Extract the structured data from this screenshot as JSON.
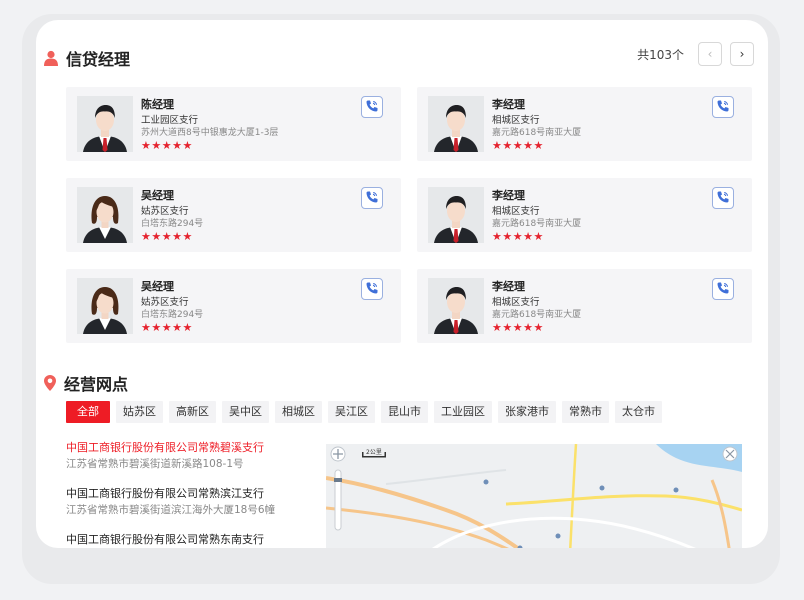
{
  "managers": {
    "title": "信贷经理",
    "total": "共103个",
    "items": [
      {
        "name": "陈经理",
        "branch": "工业园区支行",
        "address": "苏州大道西8号中银惠龙大厦1-3层",
        "stars": "★★★★★",
        "gender": "male"
      },
      {
        "name": "李经理",
        "branch": "相城区支行",
        "address": "嘉元路618号南亚大厦",
        "stars": "★★★★★",
        "gender": "male"
      },
      {
        "name": "吴经理",
        "branch": "姑苏区支行",
        "address": "白塔东路294号",
        "stars": "★★★★★",
        "gender": "female"
      },
      {
        "name": "李经理",
        "branch": "相城区支行",
        "address": "嘉元路618号南亚大厦",
        "stars": "★★★★★",
        "gender": "male"
      },
      {
        "name": "吴经理",
        "branch": "姑苏区支行",
        "address": "白塔东路294号",
        "stars": "★★★★★",
        "gender": "female"
      },
      {
        "name": "李经理",
        "branch": "相城区支行",
        "address": "嘉元路618号南亚大厦",
        "stars": "★★★★★",
        "gender": "male"
      }
    ]
  },
  "outlets": {
    "title": "经营网点",
    "filters": [
      "全部",
      "姑苏区",
      "高新区",
      "吴中区",
      "相城区",
      "吴江区",
      "昆山市",
      "工业园区",
      "张家港市",
      "常熟市",
      "太仓市"
    ],
    "active_filter": "全部",
    "branches": [
      {
        "name": "中国工商银行股份有限公司常熟碧溪支行",
        "address": "江苏省常熟市碧溪街道新溪路108-1号"
      },
      {
        "name": "中国工商银行股份有限公司常熟滨江支行",
        "address": "江苏省常熟市碧溪街道滨江海外大厦18号6幢"
      },
      {
        "name": "中国工商银行股份有限公司常熟东南支行",
        "address": ""
      }
    ],
    "map_scale": "2公里"
  },
  "colors": {
    "brand_red": "#ee1c25",
    "star_red": "#e5232f",
    "card_bg": "#f5f5f7"
  }
}
